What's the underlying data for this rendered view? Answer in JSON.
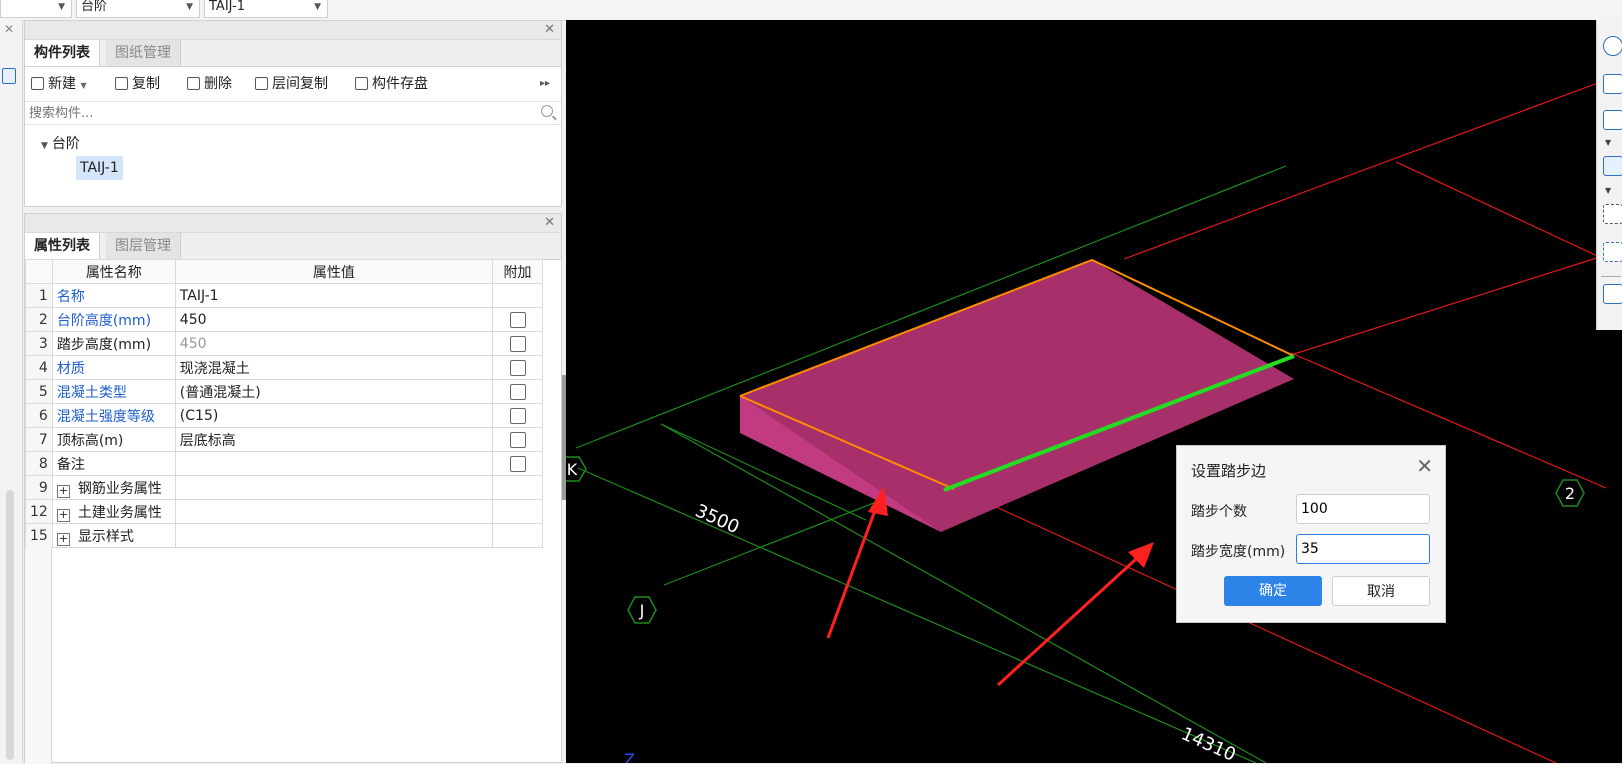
{
  "topbar": {
    "combo1": "",
    "combo2": "台阶",
    "combo3": "TAIJ-1"
  },
  "component_panel": {
    "tabs": [
      "构件列表",
      "图纸管理"
    ],
    "toolbar": {
      "new": "新建",
      "copy": "复制",
      "delete": "删除",
      "floor_copy": "层间复制",
      "save": "构件存盘"
    },
    "search_placeholder": "搜索构件...",
    "tree": {
      "group": "台阶",
      "item": "TAIJ-1"
    }
  },
  "property_panel": {
    "tabs": [
      "属性列表",
      "图层管理"
    ],
    "columns": [
      "属性名称",
      "属性值",
      "附加"
    ],
    "rows": [
      {
        "num": "1",
        "name": "名称",
        "value": "TAIJ-1"
      },
      {
        "num": "2",
        "name": "台阶高度(mm)",
        "value": "450"
      },
      {
        "num": "3",
        "name": "踏步高度(mm)",
        "value": "450"
      },
      {
        "num": "4",
        "name": "材质",
        "value": "现浇混凝土"
      },
      {
        "num": "5",
        "name": "混凝土类型",
        "value": "(普通混凝土)"
      },
      {
        "num": "6",
        "name": "混凝土强度等级",
        "value": "(C15)"
      },
      {
        "num": "7",
        "name": "顶标高(m)",
        "value": "层底标高"
      },
      {
        "num": "8",
        "name": "备注",
        "value": ""
      },
      {
        "num": "9",
        "name": "钢筋业务属性",
        "value": ""
      },
      {
        "num": "12",
        "name": "土建业务属性",
        "value": ""
      },
      {
        "num": "15",
        "name": "显示样式",
        "value": ""
      }
    ]
  },
  "viewport": {
    "axis_k": "K",
    "axis_j": "J",
    "axis_2": "2",
    "dim_3500": "3500",
    "dim_14310": "14310",
    "z_label": "Z",
    "colors": {
      "slab": "#a8306a",
      "slab_side": "#c23a82",
      "edge_orange": "#ff8c00",
      "edge_green": "#22dd22",
      "grid_red": "#e01818",
      "grid_green": "#1e8a1e",
      "arrow_red": "#ff2020"
    }
  },
  "dialog": {
    "title": "设置踏步边",
    "step_count_label": "踏步个数",
    "step_count_value": "100",
    "step_width_label": "踏步宽度(mm)",
    "step_width_value": "35",
    "ok": "确定",
    "cancel": "取消"
  }
}
